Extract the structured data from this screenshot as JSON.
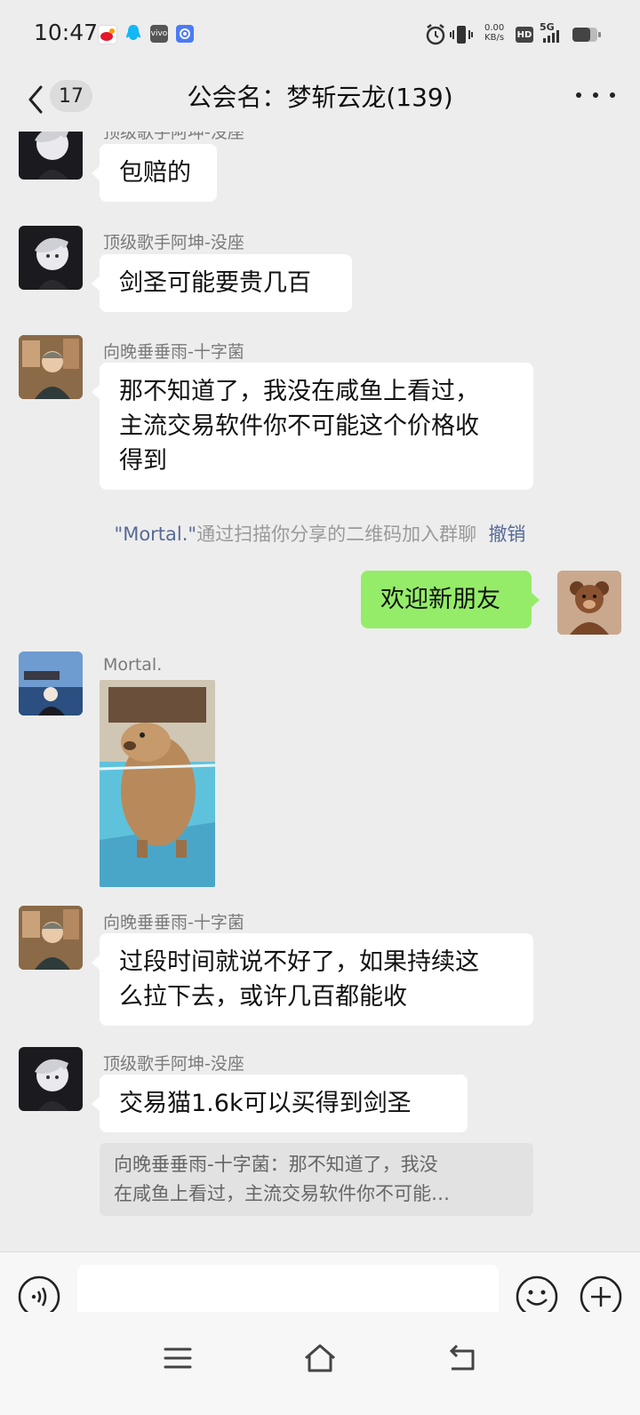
{
  "status_bar": {
    "time": "10:47",
    "network_speed_value": "0.00",
    "network_speed_unit": "KB/s",
    "hd_label": "HD",
    "network_type": "5G",
    "notification_icons": [
      "weibo-icon",
      "qq-icon",
      "vivo-icon",
      "browser-icon"
    ],
    "system_icons": [
      "alarm-icon",
      "vibrate-icon",
      "signal-icon",
      "battery-icon"
    ]
  },
  "header": {
    "back_label": "back",
    "unread_count": "17",
    "title": "公会名：梦斩云龙(139)",
    "more_icon": "more-icon"
  },
  "messages": [
    {
      "sender": "顶级歌手阿坤-没座",
      "text": "包赔的"
    },
    {
      "sender": "顶级歌手阿坤-没座",
      "text": "剑圣可能要贵几百"
    },
    {
      "sender": "向晚垂垂雨-十字菌",
      "lines": [
        "那不知道了，我没在咸鱼上看过，",
        "主流交易软件你不可能这个价格收",
        "得到"
      ]
    },
    {
      "sender": "Mortal.",
      "image_desc": "capybara"
    },
    {
      "sender": "向晚垂垂雨-十字菌",
      "lines": [
        "过段时间就说不好了，如果持续这",
        "么拉下去，或许几百都能收"
      ]
    },
    {
      "sender": "顶级歌手阿坤-没座",
      "text": "交易猫1.6k可以买得到剑圣"
    }
  ],
  "system_message": {
    "name": "\"Mortal.\"",
    "text": "通过扫描你分享的二维码加入群聊",
    "action": "撤销"
  },
  "my_message": {
    "text": "欢迎新朋友"
  },
  "quote": {
    "line1": "向晚垂垂雨-十字菌：那不知道了，我没",
    "line2": "在咸鱼上看过，主流交易软件你不可能…"
  },
  "input": {
    "value": "",
    "placeholder": "",
    "voice_icon": "voice-icon",
    "emoji_icon": "emoji-icon",
    "plus_icon": "plus-icon"
  },
  "nav": {
    "icons": [
      "menu-icon",
      "home-icon",
      "back-nav-icon"
    ]
  },
  "colors": {
    "background": "#ededed",
    "my_bubble": "#95ec69",
    "other_bubble": "#ffffff",
    "link": "#576b95"
  }
}
